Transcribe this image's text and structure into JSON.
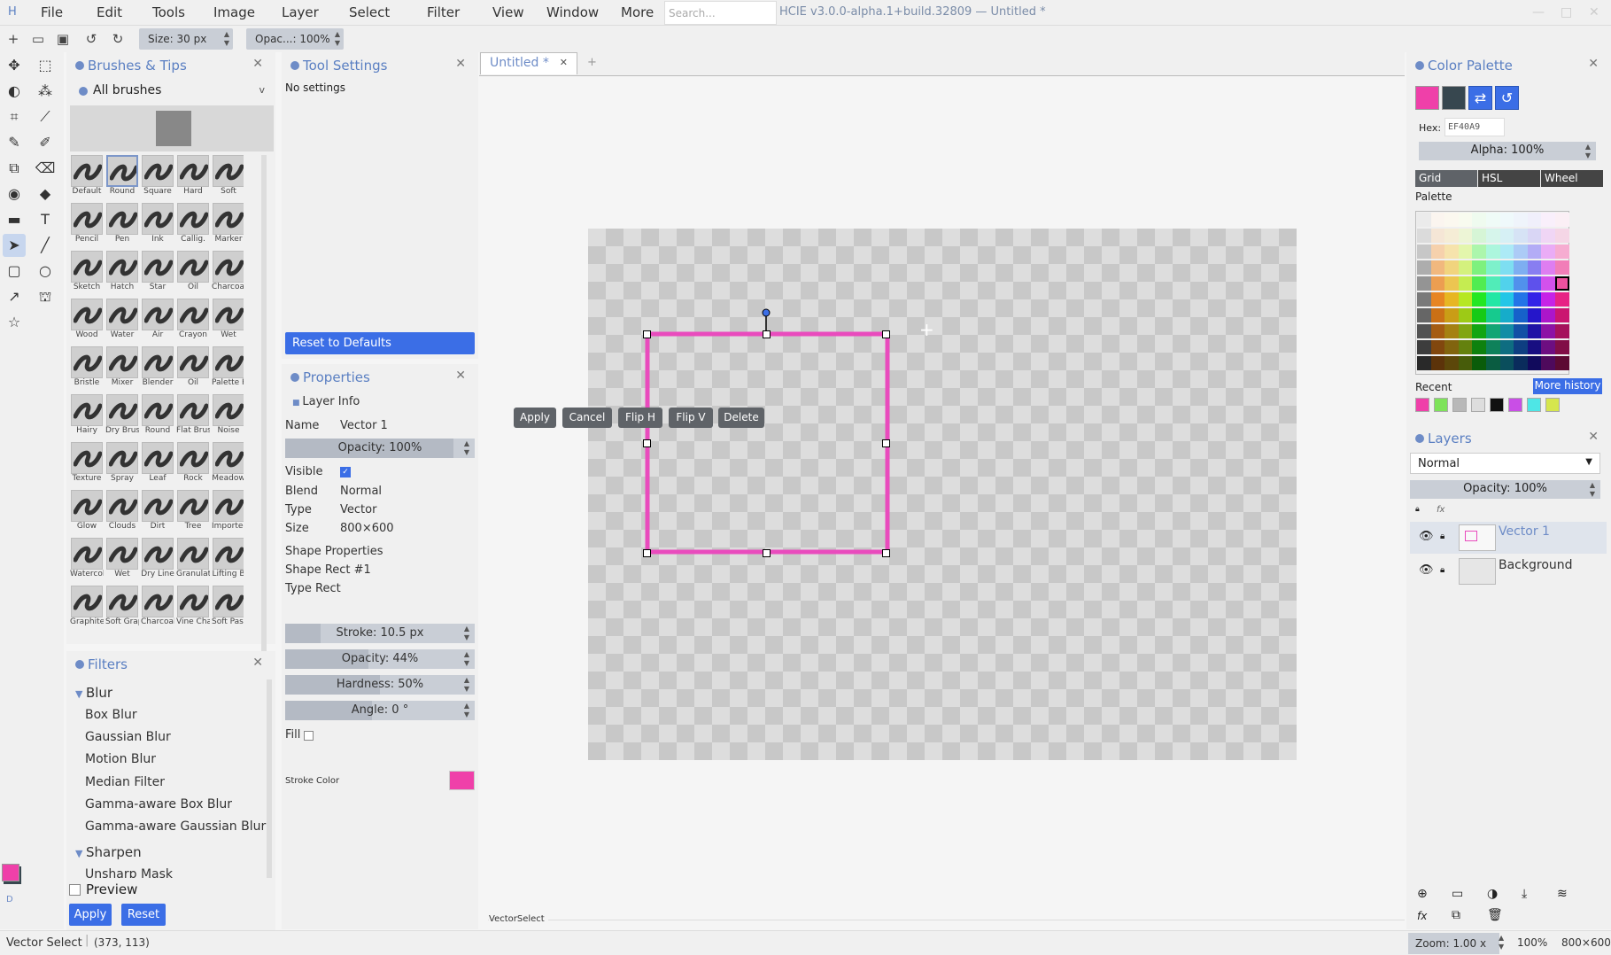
{
  "menu": {
    "logo": "H",
    "items": [
      "File",
      "Edit",
      "Tools",
      "Image",
      "Layer",
      "Select",
      "Filter",
      "View",
      "Window",
      "More"
    ],
    "search_placeholder": "Search...",
    "title": "HCIE v3.0.0-alpha.1+build.32809 — Untitled *"
  },
  "toolbar": {
    "size_label": "Size: 30 px",
    "opacity_label": "Opac...: 100%"
  },
  "brushes": {
    "title": "Brushes & Tips",
    "category": "All brushes",
    "items": [
      "Default",
      "Round",
      "Square",
      "Hard",
      "Soft",
      "Pencil",
      "Pen",
      "Ink",
      "Callig.",
      "Marker",
      "Sketch",
      "Hatch",
      "Star",
      "Oil",
      "Charcoal",
      "Wood",
      "Water",
      "Air",
      "Crayon",
      "Wet",
      "Bristle",
      "Mixer",
      "Blender",
      "Oil",
      "Palette K",
      "Hairy",
      "Dry Brush",
      "Round",
      "Flat Brus",
      "Noise",
      "Texture",
      "Spray",
      "Leaf",
      "Rock",
      "Meadow",
      "Glow",
      "Clouds",
      "Dirt",
      "Tree",
      "Imported",
      "Watercolo",
      "Wet",
      "Dry Line",
      "Granulati",
      "Lifting B",
      "Graphite",
      "Soft Grap",
      "Charcoal",
      "Vine Char",
      "Soft Past"
    ]
  },
  "filters": {
    "title": "Filters",
    "categories": [
      {
        "name": "Blur",
        "items": [
          "Box Blur",
          "Gaussian Blur",
          "Motion Blur",
          "Median Filter",
          "Gamma-aware Box Blur",
          "Gamma-aware Gaussian Blur"
        ]
      },
      {
        "name": "Sharpen",
        "items": [
          "Unsharp Mask"
        ]
      }
    ],
    "preview_label": "Preview",
    "apply_label": "Apply",
    "reset_label": "Reset"
  },
  "tool_settings": {
    "title": "Tool Settings",
    "empty_text": "No settings",
    "reset_label": "Reset to Defaults"
  },
  "properties": {
    "title": "Properties",
    "section": "Layer Info",
    "name_label": "Name",
    "name_value": "Vector 1",
    "opacity_label": "Opacity: 100%",
    "visible_label": "Visible",
    "blend_label": "Blend",
    "blend_value": "Normal",
    "type_label": "Type",
    "type_value": "Vector",
    "size_label": "Size",
    "size_value": "800×600",
    "shape_props": "Shape Properties",
    "shape_name": "Shape Rect #1",
    "shape_type": "Type Rect",
    "stroke_label": "Stroke: 10.5 px",
    "stroke_opacity_label": "Opacity: 44%",
    "hardness_label": "Hardness: 50%",
    "angle_label": "Angle: 0 °",
    "fill_label": "Fill",
    "stroke_color_label": "Stroke Color",
    "stroke_color": "#EF40A9"
  },
  "canvas": {
    "tab_label": "Untitled *",
    "add_tab": "+",
    "shape_buttons": [
      "Apply",
      "Cancel",
      "Flip H",
      "Flip V",
      "Delete"
    ],
    "tool_hint": "VectorSelect",
    "stroke_color": "#e94bbd"
  },
  "color_palette": {
    "title": "Color Palette",
    "primary": "#EF40A9",
    "secondary": "#37474f",
    "hex_label": "Hex:",
    "hex_value": "EF40A9",
    "alpha_label": "Alpha: 100%",
    "tabs": [
      "Grid",
      "HSL",
      "Wheel"
    ],
    "palette_label": "Palette",
    "recent_label": "Recent",
    "more_history": "More history",
    "recent_colors": [
      "#EF40A9",
      "#7ee35a",
      "#b8b8b8",
      "#dddddd",
      "#111111",
      "#c94ee6",
      "#4ee6e6",
      "#d6e64e"
    ]
  },
  "layers": {
    "title": "Layers",
    "blend": "Normal",
    "opacity_label": "Opacity: 100%",
    "items": [
      {
        "name": "Vector 1",
        "selected": true
      },
      {
        "name": "Background",
        "selected": false
      }
    ]
  },
  "status": {
    "tool": "Vector Select",
    "coords": "(373, 113)",
    "zoom_label": "Zoom: 1.00 x",
    "zoom_pct": "100%",
    "size": "800×600",
    "version_mark": "D"
  }
}
